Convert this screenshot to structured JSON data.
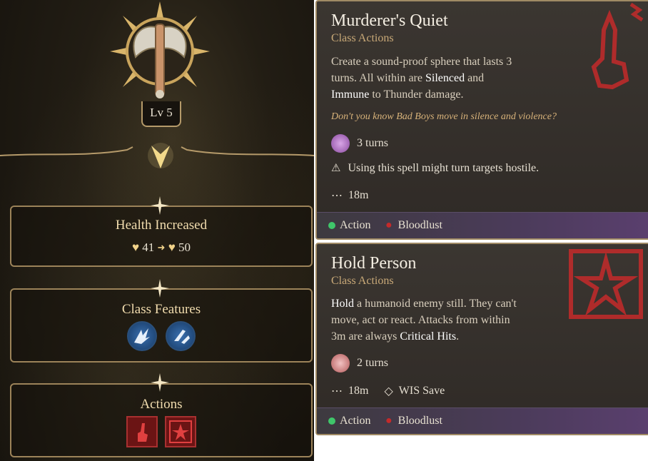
{
  "levelup": {
    "level_label": "Lv 5",
    "health": {
      "title": "Health Increased",
      "from": "41",
      "to": "50"
    },
    "class_features": {
      "title": "Class Features",
      "icons": [
        "dash-icon",
        "slash-strike-icon"
      ]
    },
    "actions": {
      "title": "Actions",
      "icons": [
        "murderers-quiet-icon",
        "hold-person-icon"
      ]
    }
  },
  "spells": [
    {
      "name": "Murderer's Quiet",
      "category": "Class Actions",
      "desc_lines": [
        [
          "Create a sound-proof sphere that lasts 3"
        ],
        [
          "turns. All within are ",
          "Silenced",
          " and"
        ],
        [
          "Immune",
          " to Thunder damage."
        ]
      ],
      "quote": "Don't you know Bad Boys move in silence and violence?",
      "duration": "3 turns",
      "warning": "Using this spell might turn targets hostile.",
      "range": "18m",
      "cost": "Action",
      "resource": "Bloodlust"
    },
    {
      "name": "Hold Person",
      "category": "Class Actions",
      "desc_lines": [
        [
          "Hold",
          " a humanoid enemy still. They can't"
        ],
        [
          "move, act or react. Attacks from within"
        ],
        [
          "3m are always ",
          "Critical Hits",
          "."
        ]
      ],
      "duration": "2 turns",
      "range": "18m",
      "save": "WIS Save",
      "cost": "Action",
      "resource": "Bloodlust"
    }
  ],
  "colors": {
    "accent_gold": "#b59a6a",
    "action_green": "#3fc66a",
    "blood_red": "#c42a2a"
  }
}
